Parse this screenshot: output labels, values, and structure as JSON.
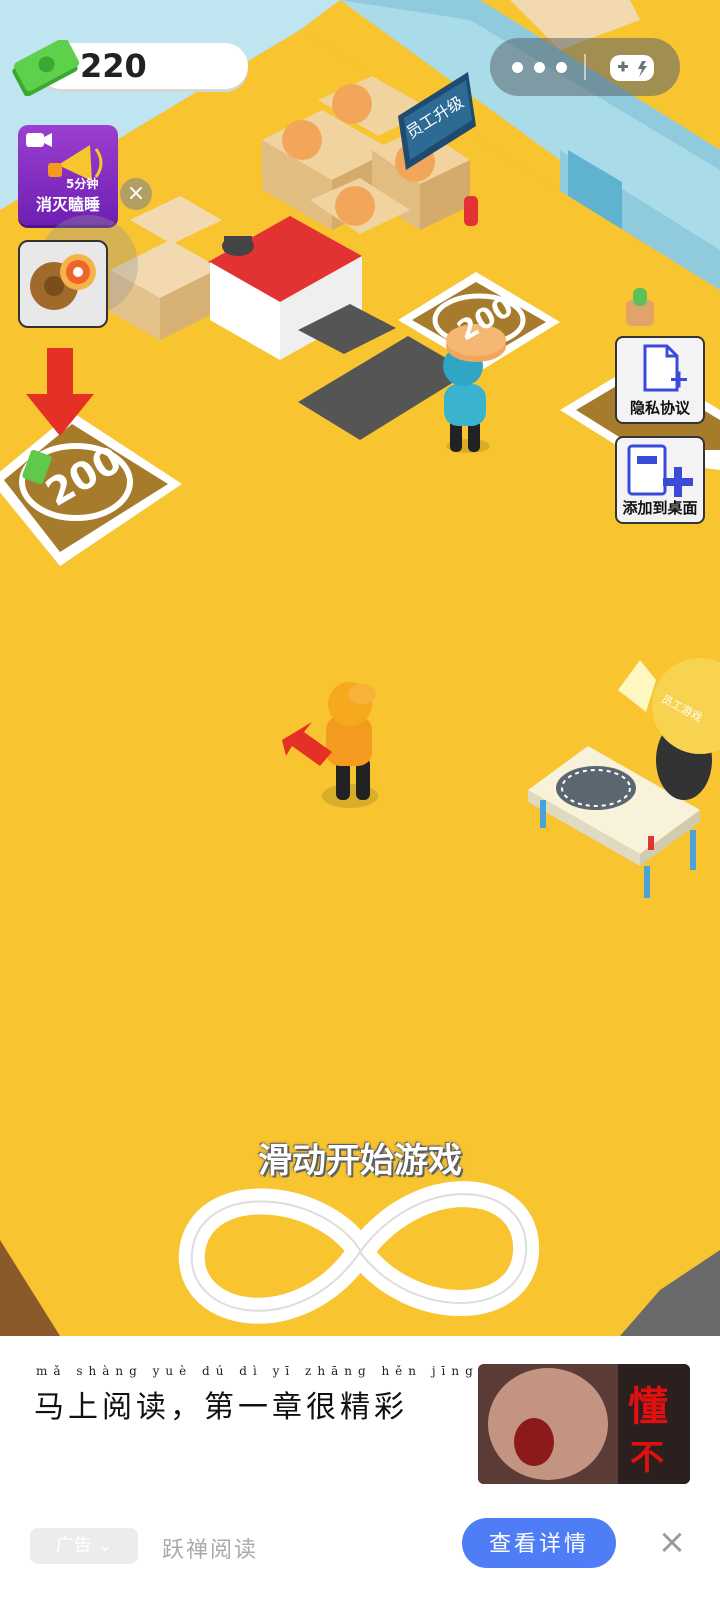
{
  "hud": {
    "money": "220",
    "ad_reward": {
      "timer": "5分钟",
      "label": "消灭瞌睡"
    },
    "capsule": {
      "more_icon": "more-dots-icon",
      "game_icon": "gamepad-icon"
    },
    "side_buttons": [
      {
        "label": "隐私协议"
      },
      {
        "label": "添加到桌面"
      }
    ]
  },
  "world": {
    "upgrade_sign": "员工升级",
    "left_pad_price": "200",
    "oven_pad_price": "200",
    "table_sign": "员工游戏"
  },
  "hint": {
    "start_text": "滑动开始游戏"
  },
  "ad": {
    "pinyin": "mǎ shàng yuè dú   dì yī zhāng hěn jīng cǎi",
    "headline": "马上阅读，第一章很精彩",
    "thumb_text_1": "懂",
    "thumb_text_2": "不",
    "tag": "广告",
    "source": "跃禅阅读",
    "cta": "查看详情",
    "close_icon": "close-icon"
  },
  "colors": {
    "floor": "#f8c42f",
    "wall": "#a9dbe9",
    "cta": "#4f7df5",
    "accent_red": "#e53125"
  }
}
